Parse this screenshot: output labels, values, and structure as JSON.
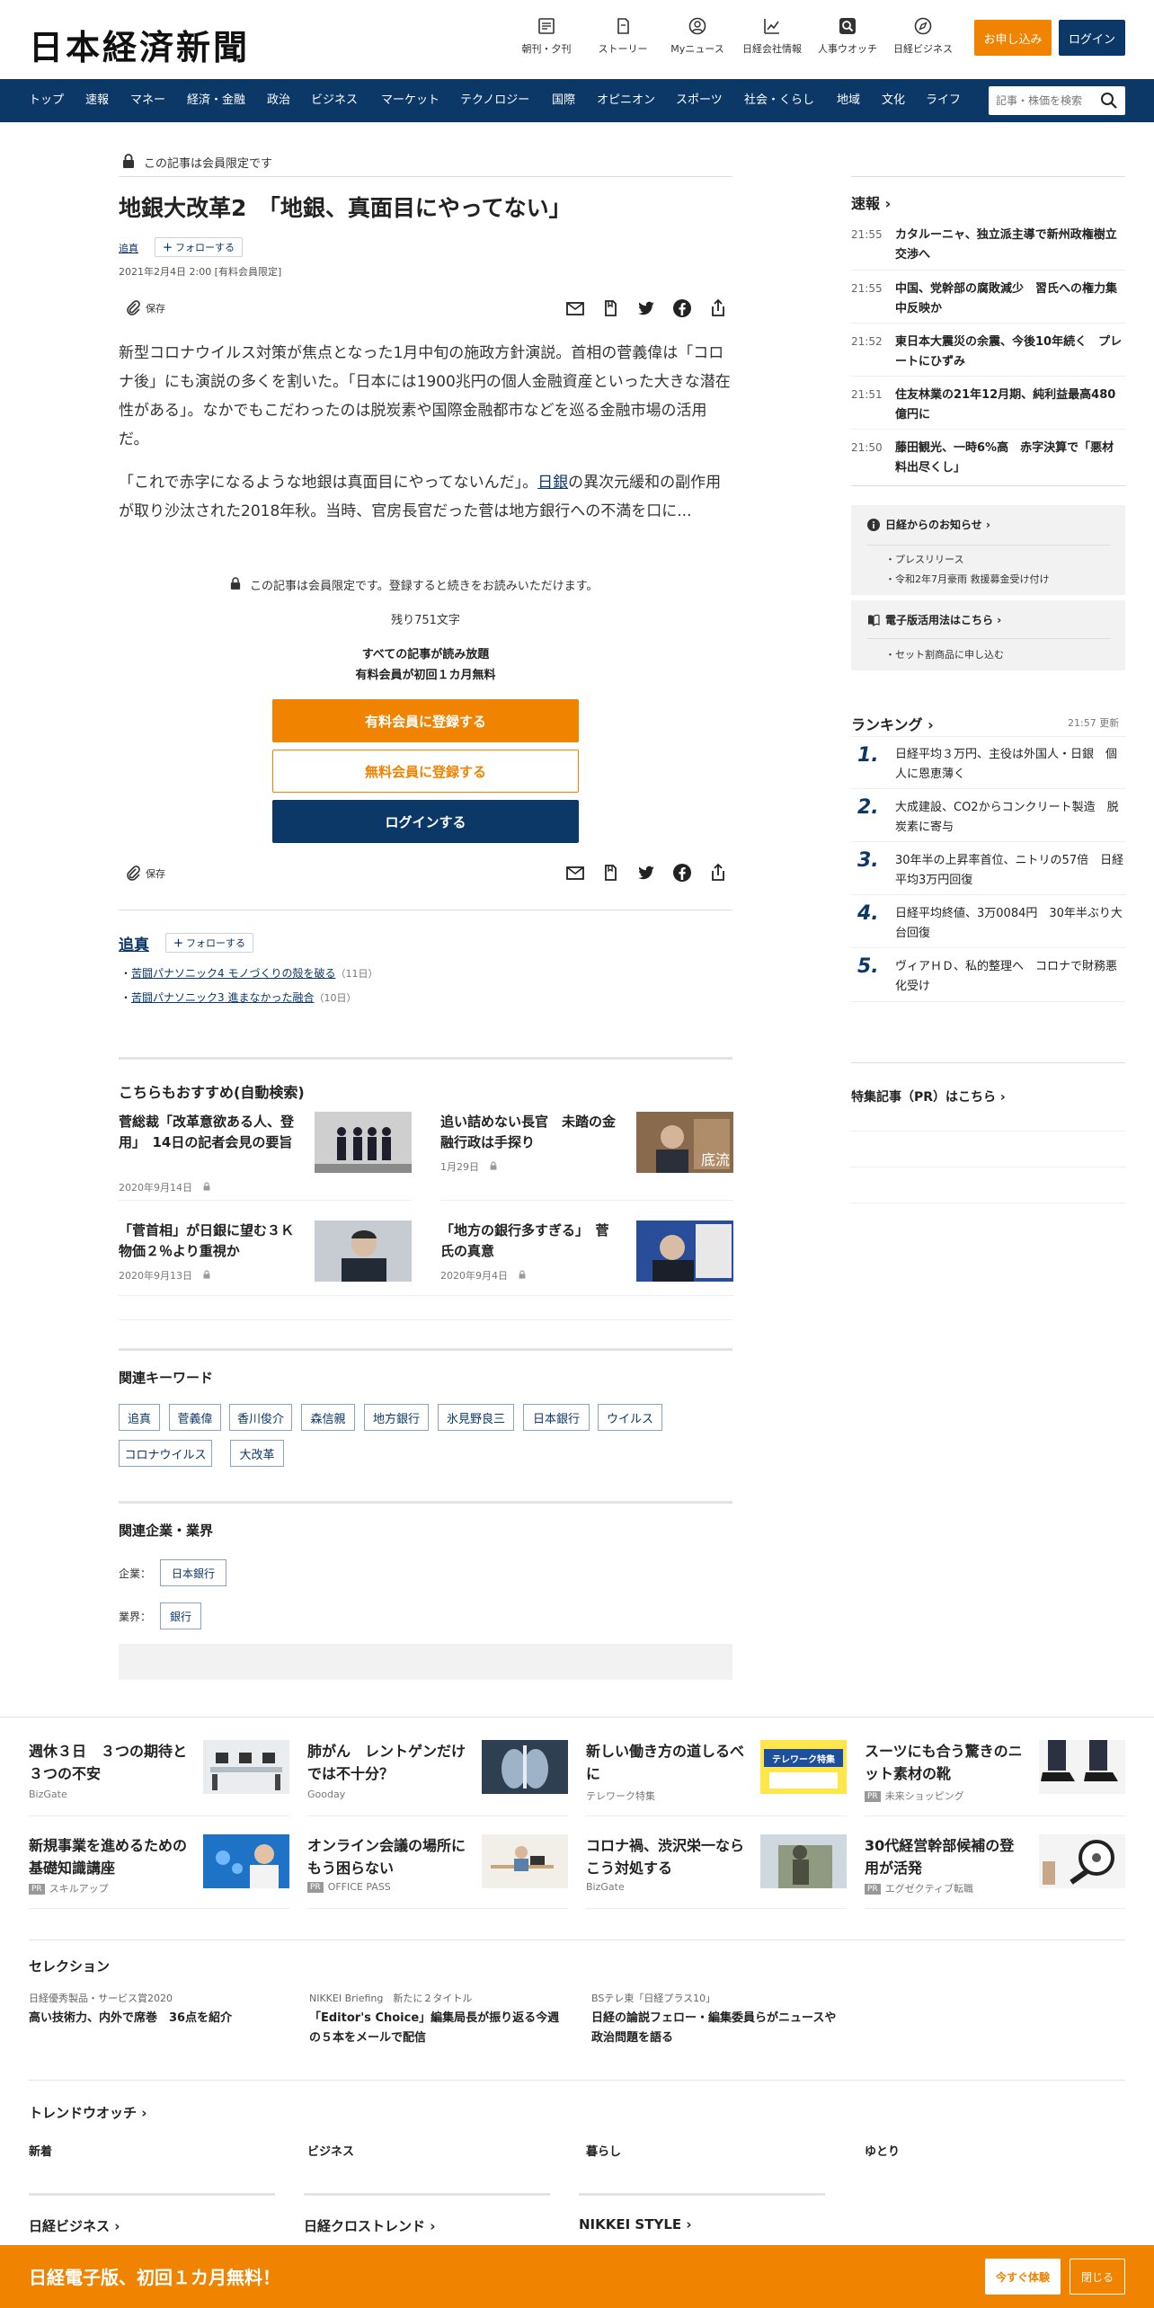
{
  "header": {
    "logo": "日本経済新聞",
    "icons": [
      {
        "label": "朝刊・夕刊",
        "icon": "newspaper-icon"
      },
      {
        "label": "ストーリー",
        "icon": "story-icon"
      },
      {
        "label": "Myニュース",
        "icon": "user-icon"
      },
      {
        "label": "日経会社情報",
        "icon": "chart-icon"
      },
      {
        "label": "人事ウオッチ",
        "icon": "magnifier-icon"
      },
      {
        "label": "日経ビジネス",
        "icon": "compass-icon"
      }
    ],
    "apply_label": "お申し込み",
    "login_label": "ログイン"
  },
  "nav": {
    "items": [
      "トップ",
      "速報",
      "マネー",
      "経済・金融",
      "政治",
      "ビジネス",
      "マーケット",
      "テクノロジー",
      "国際",
      "オピニオン",
      "スポーツ",
      "社会・くらし",
      "地域",
      "文化",
      "ライフ"
    ],
    "search_placeholder": "記事・株価を検索"
  },
  "article": {
    "member_only": "この記事は会員限定です",
    "title": "地銀大改革2　「地銀、真面目にやってない」",
    "series": "追真",
    "follow": "フォローする",
    "date": "2021年2月4日 2:00 [有料会員限定]",
    "save": "保存",
    "para1": "新型コロナウイルス対策が焦点となった1月中旬の施政方針演説。首相の菅義偉は「コロナ後」にも演説の多くを割いた。「日本には1900兆円の個人金融資産といった大きな潜在性がある」。なかでもこだわったのは脱炭素や国際金融都市などを巡る金融市場の活用だ。",
    "para2_before": "「これで赤字になるような地銀は真面目にやってないんだ」。",
    "para2_link": "日銀",
    "para2_after": "の異次元緩和の副作用が取り沙汰された2018年秋。当時、官房長官だった菅は地方銀行への不満を口に...",
    "paywall_note": "この記事は会員限定です。登録すると続きをお読みいただけます。",
    "remaining": "残り751文字",
    "pitch1": "すべての記事が読み放題",
    "pitch2": "有料会員が初回１カ月無料",
    "cta_paid": "有料会員に登録する",
    "cta_free": "無料会員に登録する",
    "cta_login": "ログインする"
  },
  "series_box": {
    "title": "追真",
    "follow": "フォローする",
    "links": [
      {
        "text": "苦闘パナソニック4 モノづくりの殻を破る",
        "count": "（11日）"
      },
      {
        "text": "苦闘パナソニック3 進まなかった融合",
        "count": "（10日）"
      }
    ]
  },
  "recommend": {
    "heading": "こちらもおすすめ(自動検索)",
    "items": [
      {
        "title": "菅総裁「改革意欲ある人、登用」　14日の記者会見の要旨",
        "date": "2020年9月14日"
      },
      {
        "title": "追い詰めない長官　未踏の金融行政は手探り",
        "date": "1月29日",
        "badge": "底流"
      },
      {
        "title": "「菅首相」が日銀に望む３Ｋ　物価２％より重視か",
        "date": "2020年9月13日"
      },
      {
        "title": "「地方の銀行多すぎる」　菅氏の真意",
        "date": "2020年9月4日"
      }
    ]
  },
  "keywords": {
    "heading": "関連キーワード",
    "items": [
      "追真",
      "菅義偉",
      "香川俊介",
      "森信親",
      "地方銀行",
      "氷見野良三",
      "日本銀行",
      "ウイルス",
      "コロナウイルス",
      "大改革"
    ]
  },
  "companies": {
    "heading": "関連企業・業界",
    "company_label": "企業：",
    "company": "日本銀行",
    "industry_label": "業界：",
    "industry": "銀行"
  },
  "sidebar": {
    "sokuho_title": "速報",
    "sokuho": [
      {
        "time": "21:55",
        "title": "カタルーニャ、独立派主導で新州政権樹立交渉へ"
      },
      {
        "time": "21:55",
        "title": "中国、党幹部の腐敗減少　習氏への権力集中反映か"
      },
      {
        "time": "21:52",
        "title": "東日本大震災の余震、今後10年続く　プレートにひずみ"
      },
      {
        "time": "21:51",
        "title": "住友林業の21年12月期、純利益最高480億円に"
      },
      {
        "time": "21:50",
        "title": "藤田観光、一時6%高　赤字決算で「悪材料出尽くし」"
      }
    ],
    "notice_title": "日経からのお知らせ",
    "notice_items": [
      "プレスリリース",
      "令和2年7月豪雨 救援募金受け付け"
    ],
    "digital_title": "電子版活用法はこちら",
    "digital_items": [
      "セット割商品に申し込む"
    ],
    "ranking_title": "ランキング",
    "ranking_time": "21:57 更新",
    "ranking": [
      {
        "rank": "1.",
        "title": "日経平均３万円、主役は外国人・日銀　個人に恩恵薄く"
      },
      {
        "rank": "2.",
        "title": "大成建設、CO2からコンクリート製造　脱炭素に寄与"
      },
      {
        "rank": "3.",
        "title": "30年半の上昇率首位、ニトリの57倍　日経平均3万円回復"
      },
      {
        "rank": "4.",
        "title": "日経平均終値、3万0084円　30年半ぶり大台回復"
      },
      {
        "rank": "5.",
        "title": "ヴィアＨＤ、私的整理へ　コロナで財務悪化受け"
      }
    ],
    "pr_title": "特集記事（PR）はこちら"
  },
  "bottom": {
    "cards": [
      {
        "title": "週休３日　３つの期待と３つの不安",
        "source": "BizGate",
        "pr": false
      },
      {
        "title": "肺がん　レントゲンだけでは不十分？",
        "source": "Gooday",
        "pr": false
      },
      {
        "title": "新しい働き方の道しるべに",
        "source": "テレワーク特集",
        "pr": false,
        "badge": "テレワーク特集"
      },
      {
        "title": "スーツにも合う驚きのニット素材の靴",
        "source": "未来ショッピング",
        "pr": true
      },
      {
        "title": "新規事業を進めるための基礎知識講座",
        "source": "スキルアップ",
        "pr": true
      },
      {
        "title": "オンライン会議の場所にもう困らない",
        "source": "OFFICE PASS",
        "pr": true
      },
      {
        "title": "コロナ禍、渋沢栄一ならこう対処する",
        "source": "BizGate",
        "pr": false
      },
      {
        "title": "30代経営幹部候補の登用が活発",
        "source": "エグゼクティブ転職",
        "pr": true
      }
    ],
    "pr_label": "PR",
    "selection_title": "セレクション",
    "selection": [
      {
        "kicker": "日経優秀製品・サービス賞2020",
        "title": "高い技術力、内外で席巻　36点を紹介"
      },
      {
        "kicker": "NIKKEI Briefing　新たに２タイトル",
        "title": "「Editor's Choice」編集局長が振り返る今週の５本をメールで配信"
      },
      {
        "kicker": "BSテレ東「日経プラス10」",
        "title": "日経の論説フェロー・編集委員らがニュースや政治問題を語る"
      }
    ],
    "trend_title": "トレンドウオッチ",
    "trend_tabs": [
      "新着",
      "ビジネス",
      "暮らし",
      "ゆとり"
    ],
    "media": [
      "日経ビジネス",
      "日経クロストレンド",
      "NIKKEI STYLE"
    ]
  },
  "footer": {
    "promo": "日経電子版、初回１カ月無料！",
    "try": "今すぐ体験",
    "close": "閉じる"
  },
  "colors": {
    "navy": "#0b3866",
    "orange": "#f08300"
  }
}
